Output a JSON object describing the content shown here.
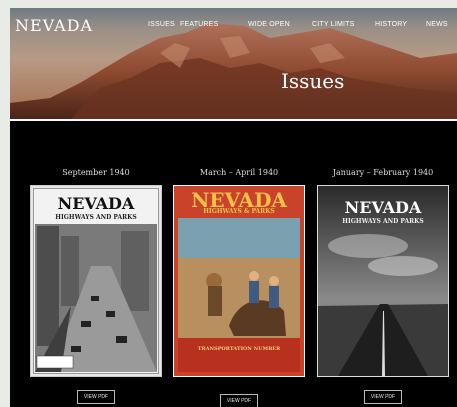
{
  "header": {
    "logo": "NEVADA",
    "nav": [
      "ISSUES",
      "FEATURES",
      "WIDE OPEN",
      "CITY LIMITS",
      "HISTORY",
      "NEWS"
    ]
  },
  "hero": {
    "title": "Issues"
  },
  "issues": [
    {
      "date": "September 1940",
      "cover_title": "NEVADA",
      "cover_subtitle": "HIGHWAYS AND PARKS",
      "button": "VIEW PDF"
    },
    {
      "date": "March – April 1940",
      "cover_title": "NEVADA",
      "cover_subtitle": "HIGHWAYS & PARKS",
      "cover_footer": "TRANSPORTATION NUMBER",
      "button": "VIEW PDF"
    },
    {
      "date": "January – February 1940",
      "cover_title": "NEVADA",
      "cover_subtitle": "HIGHWAYS AND PARKS",
      "button": "VIEW PDF"
    }
  ]
}
